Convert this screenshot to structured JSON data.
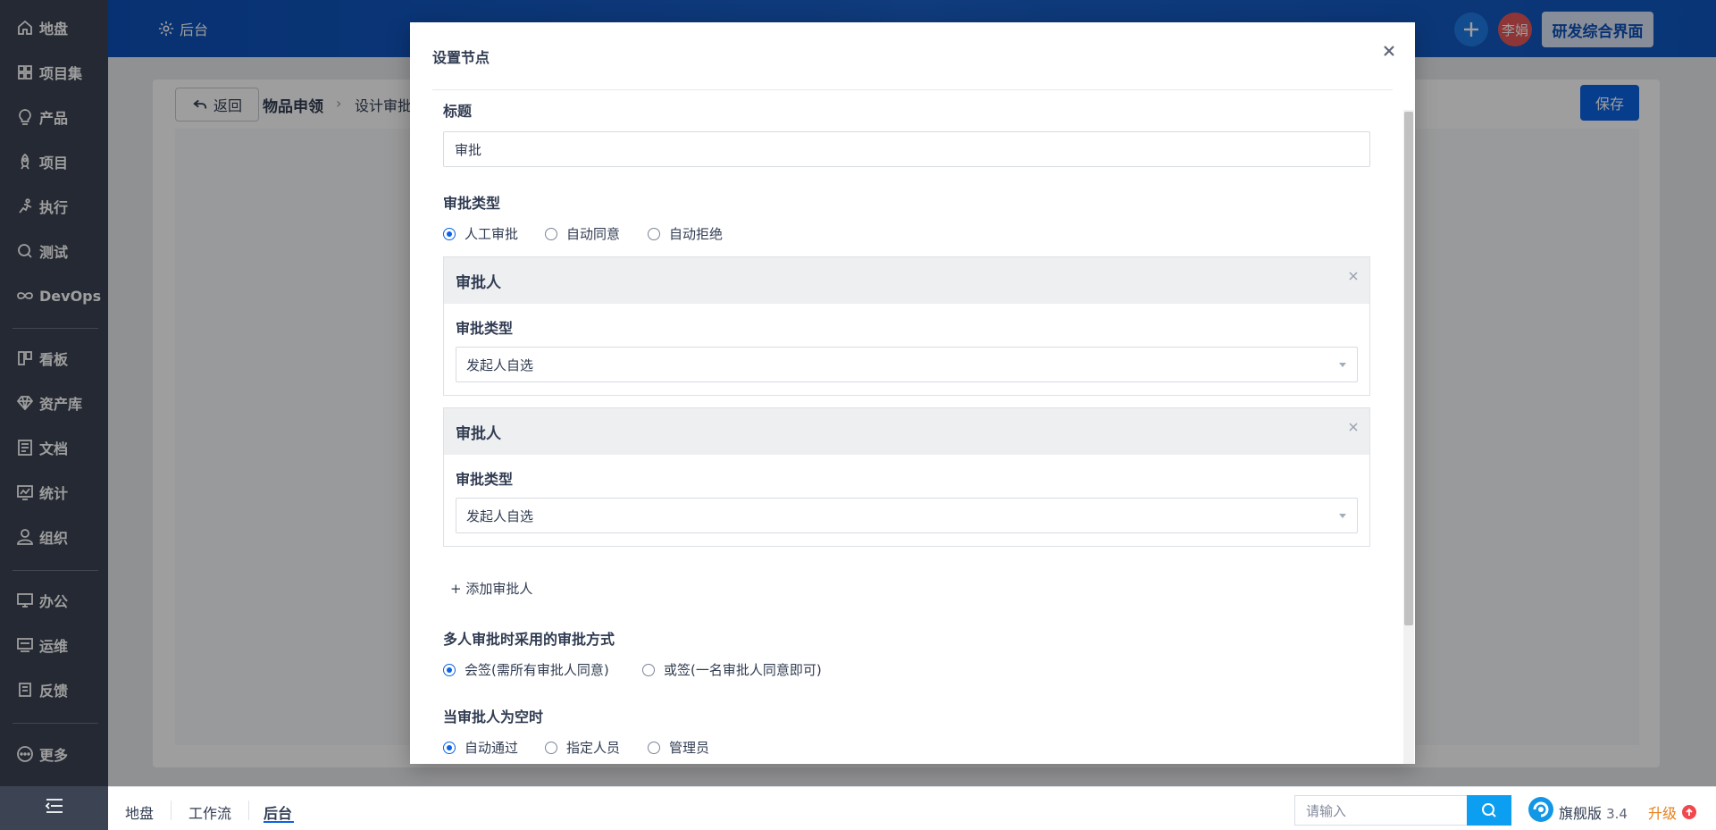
{
  "sidebar": {
    "items": [
      {
        "label": "地盘",
        "icon": "home-icon"
      },
      {
        "label": "项目集",
        "icon": "grid-icon"
      },
      {
        "label": "产品",
        "icon": "lightbulb-icon"
      },
      {
        "label": "项目",
        "icon": "rocket-icon"
      },
      {
        "label": "执行",
        "icon": "runner-icon"
      },
      {
        "label": "测试",
        "icon": "magnifier-icon"
      },
      {
        "label": "DevOps",
        "icon": "infinity-icon"
      },
      {
        "label": "看板",
        "icon": "kanban-icon"
      },
      {
        "label": "资产库",
        "icon": "diamond-icon"
      },
      {
        "label": "文档",
        "icon": "document-icon"
      },
      {
        "label": "统计",
        "icon": "chart-icon"
      },
      {
        "label": "组织",
        "icon": "person-icon"
      },
      {
        "label": "办公",
        "icon": "oa-icon"
      },
      {
        "label": "运维",
        "icon": "ops-icon"
      },
      {
        "label": "反馈",
        "icon": "feedback-icon"
      },
      {
        "label": "更多",
        "icon": "more-icon"
      }
    ]
  },
  "header": {
    "backstage_label": "后台",
    "avatar_text": "李娟",
    "rd_button": "研发综合界面"
  },
  "page": {
    "back_label": "返回",
    "crumb_main": "物品申领",
    "crumb_sub": "设计审批",
    "save_label": "保存"
  },
  "modal": {
    "title": "设置节点",
    "title_label": "标题",
    "title_value": "审批",
    "approval_type_label": "审批类型",
    "approval_type_options": [
      "人工审批",
      "自动同意",
      "自动拒绝"
    ],
    "approvers": [
      {
        "header": "审批人",
        "type_label": "审批类型",
        "type_value": "发起人自选"
      },
      {
        "header": "审批人",
        "type_label": "审批类型",
        "type_value": "发起人自选"
      }
    ],
    "add_approver": "+ 添加审批人",
    "multi_label": "多人审批时采用的审批方式",
    "multi_options": [
      "会签(需所有审批人同意)",
      "或签(一名审批人同意即可)"
    ],
    "empty_label": "当审批人为空时",
    "empty_options": [
      "自动通过",
      "指定人员",
      "管理员"
    ]
  },
  "bottom": {
    "tabs": [
      "地盘",
      "工作流",
      "后台"
    ],
    "search_placeholder": "请输入",
    "version_name": "旗舰版",
    "version_number": "3.4",
    "upgrade_label": "升级"
  },
  "colors": {
    "sidebar_bg": "#3c4353",
    "header_blue": "#0c50b8",
    "primary": "#0c63e4",
    "upgrade": "#e87f1b"
  }
}
